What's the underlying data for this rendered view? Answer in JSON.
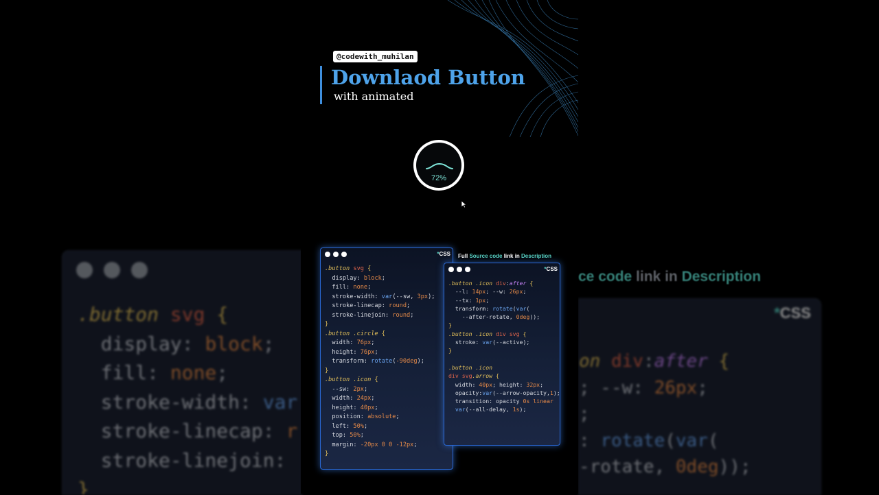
{
  "handle": "@codewith_muhilan",
  "title": "Downlaod Button",
  "subtitle": "with animated",
  "progress_label": "72%",
  "caption": {
    "pre": "Full ",
    "acc1": "Source code",
    "mid": " link in ",
    "acc2": "Description"
  },
  "bg_caption": {
    "pre": "ce code",
    "mid": " link in ",
    "acc": "Description"
  },
  "css_tag": "CSS",
  "css_star": "*",
  "colors": {
    "accent": "#4ea3ea",
    "teal": "#5ad6c7",
    "panel_glow": "#2a6ad9",
    "background": "#000000"
  }
}
